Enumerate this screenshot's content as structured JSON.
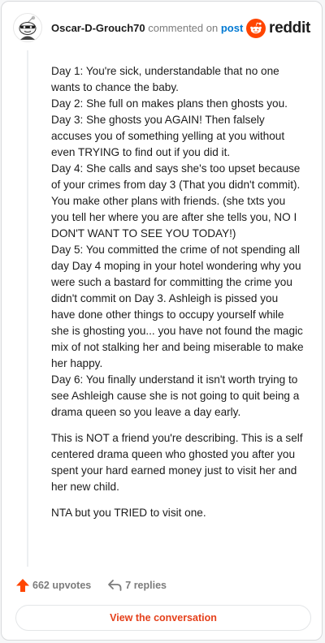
{
  "header": {
    "author": "Oscar-D-Grouch70",
    "meta_text": "commented on",
    "post_link": "post",
    "brand": "reddit",
    "brand_color": "#ff4500",
    "link_color": "#0079d3"
  },
  "comment": {
    "day_log": "Day 1: You're sick, understandable that no one wants to chance the baby.\nDay 2: She full on makes plans then ghosts you.\nDay 3: She ghosts you AGAIN! Then falsely accuses you of something yelling at you without even TRYING to find out if you did it.\nDay 4: She calls and says she's too upset because of your crimes from day 3 (That you didn't commit). You make other plans with friends. (she txts you you tell her where you are after she tells you, NO I DON'T WANT TO SEE YOU TODAY!)\nDay 5: You committed the crime of not spending all day Day 4 moping in your hotel wondering why you were such a bastard for committing the crime you didn't commit on Day 3. Ashleigh is pissed you have done other things to occupy yourself while she is ghosting you... you have not found the magic mix of not stalking her and being miserable to make her happy.\nDay 6: You finally understand it isn't worth trying to see Ashleigh cause she is not going to quit being a drama queen so you leave a day early.",
    "paragraph_2": "This is NOT a friend you're describing. This is a self centered drama queen who ghosted you after you spent your hard earned money just to visit her and her new child.",
    "paragraph_3": "NTA but you TRIED to visit one."
  },
  "footer": {
    "upvotes": "662 upvotes",
    "replies": "7 replies",
    "view_button": "View the conversation",
    "accent_color": "#e5401b"
  },
  "icons": {
    "avatar": "snoo-avatar-icon",
    "brand": "reddit-logo-icon",
    "upvote": "upvote-arrow-icon",
    "reply": "reply-arrow-icon"
  }
}
